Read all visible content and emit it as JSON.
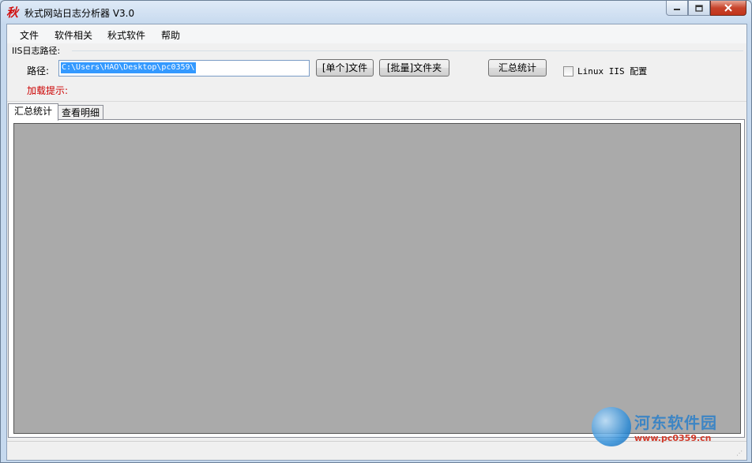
{
  "window": {
    "title": "秋式网站日志分析器 V3.0",
    "icon_glyph": "秋",
    "min_icon": "minimize-icon",
    "max_icon": "maximize-icon",
    "close_icon": "close-icon"
  },
  "menu": {
    "file": "文件",
    "software_related": "软件相关",
    "qiushi_software": "秋式软件",
    "help": "帮助"
  },
  "form": {
    "group_label": "IIS日志路径:",
    "path_label": "路径:",
    "path_value": "C:\\Users\\HAO\\Desktop\\pc0359\\",
    "single_file_button": "[单个]文件",
    "batch_folder_button": "[批量]文件夹",
    "summary_button": "汇总统计",
    "linux_checkbox_label": "Linux IIS 配置",
    "linux_checked": false,
    "load_hint": "加载提示:"
  },
  "tabs": [
    {
      "label": "汇总统计",
      "active": true
    },
    {
      "label": "查看明细",
      "active": false
    }
  ],
  "watermark": {
    "name": "河东软件园",
    "url": "www.pc0359.cn"
  },
  "colors": {
    "hint_red": "#cc0000",
    "grid_gray": "#aaaaaa",
    "selection_blue": "#3399ff"
  }
}
